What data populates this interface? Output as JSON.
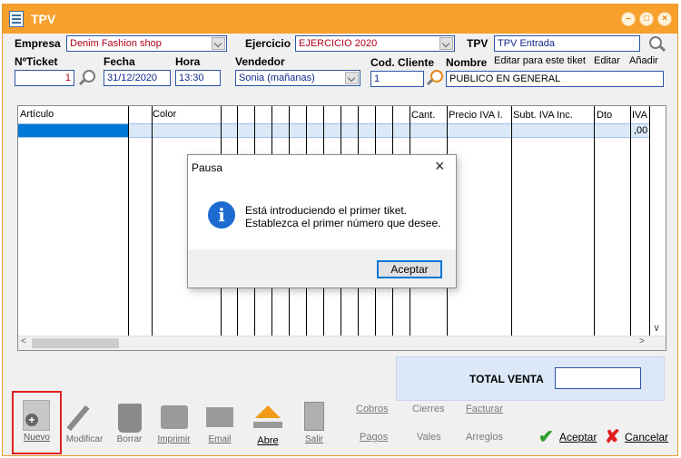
{
  "window": {
    "title": "TPV"
  },
  "header": {
    "empresa_label": "Empresa",
    "empresa_value": "Denim Fashion shop",
    "ejercicio_label": "Ejercicio",
    "ejercicio_value": "EJERCICIO 2020",
    "tpv_label": "TPV",
    "tpv_value": "TPV Entrada",
    "ticket_label": "NºTicket",
    "ticket_value": "1",
    "fecha_label": "Fecha",
    "fecha_value": "31/12/2020",
    "hora_label": "Hora",
    "hora_value": "13:30",
    "vendedor_label": "Vendedor",
    "vendedor_value": "Sonia (mañanas)",
    "codcliente_label": "Cod. Cliente",
    "codcliente_value": "1",
    "nombre_label": "Nombre",
    "nombre_value": "PUBLICO EN GENERAL",
    "editar_ticket": "Editar para este tiket",
    "editar": "Editar",
    "anadir": "Añadir"
  },
  "grid": {
    "columns": [
      "Artículo",
      "Color",
      "Cant.",
      "Precio IVA I.",
      "Subt. IVA Inc.",
      "Dto",
      "IVA"
    ],
    "row1_iva": ",00"
  },
  "totals": {
    "label": "TOTAL VENTA",
    "value": ""
  },
  "toolbar": {
    "nuevo": "Nuevo",
    "modificar": "Modificar",
    "borrar": "Borrar",
    "imprimir": "Imprimir",
    "email": "Email",
    "abre": "Abre",
    "salir": "Salir"
  },
  "links": {
    "cobros": "Cobros",
    "cierres": "Cierres",
    "facturar": "Facturar",
    "pagos": "Pagos",
    "vales": "Vales",
    "arreglos": "Arreglos"
  },
  "actions": {
    "aceptar": "Aceptar",
    "cancelar": "Cancelar"
  },
  "dialog": {
    "title": "Pausa",
    "line1": "Está introduciendo el primer tiket.",
    "line2": "Establezca el primer número que desee.",
    "button": "Aceptar"
  },
  "colors": {
    "titlebar": "#f7a02c",
    "accent": "#0078d7",
    "highlight": "#e02020"
  }
}
